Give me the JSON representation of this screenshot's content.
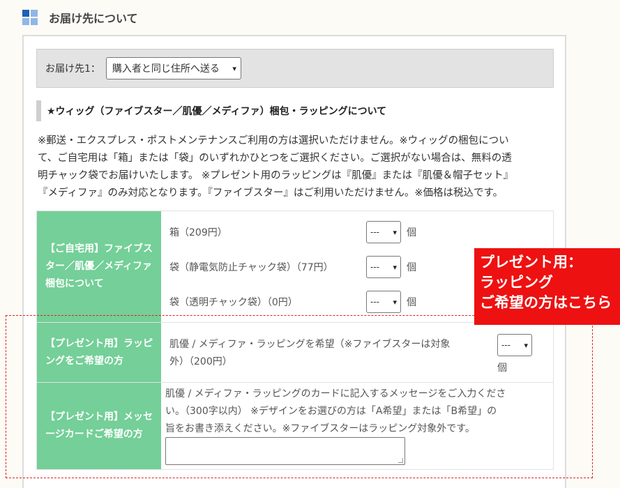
{
  "header": {
    "title": "お届け先について"
  },
  "destination": {
    "label": "お届け先1：",
    "selected": "購入者と同じ住所へ送る"
  },
  "section_title": "★ウィッグ（ファイブスター／肌優／メディファ）梱包・ラッピングについて",
  "notes": [
    "※郵送・エクスプレス・ポストメンテナンスご利用の方は選択いただけません。※ウィッグの梱包につい",
    "て、ご自宅用は「箱」または「袋」のいずれかひとつをご選択ください。ご選択がない場合は、無料の透",
    "明チャック袋でお届けいたします。 ※プレゼント用のラッピングは『肌優』または『肌優＆帽子セット』",
    "『メディファ』のみ対応となります。『ファイブスター』はご利用いただけません。※価格は税込です。"
  ],
  "rows": {
    "home": {
      "header": "【ご自宅用】ファイブスター／肌優／メディファ　梱包について",
      "items": [
        {
          "label": "箱（209円）",
          "value": "---",
          "unit": "個"
        },
        {
          "label": "袋（静電気防止チャック袋）（77円）",
          "value": "---",
          "unit": "個"
        },
        {
          "label": "袋（透明チャック袋）（0円）",
          "value": "---",
          "unit": "個"
        }
      ]
    },
    "gift": {
      "header": "【プレゼント用】ラッピングをご希望の方",
      "line1": "肌優 / メディファ・ラッピングを希望（※ファイブスターは対象",
      "line2": "外）（200円）",
      "value": "---",
      "unit": "個"
    },
    "message": {
      "header": "【プレゼント用】メッセージカードご希望の方",
      "lines": [
        "肌優 / メディファ・ラッピングのカードに記入するメッセージをご入力くださ",
        "い。（300字以内） ※デザインをお選びの方は「A希望」または「B希望」の",
        "旨をお書き添えください。※ファイブスターはラッピング対象外です。"
      ]
    }
  },
  "callout": {
    "lines": [
      "プレゼント用：",
      "ラッピング",
      "ご希望の方はこちら"
    ]
  },
  "colors": {
    "table_header": "#74cf98",
    "callout": "#ee1111",
    "dashed_border": "#e02020"
  }
}
